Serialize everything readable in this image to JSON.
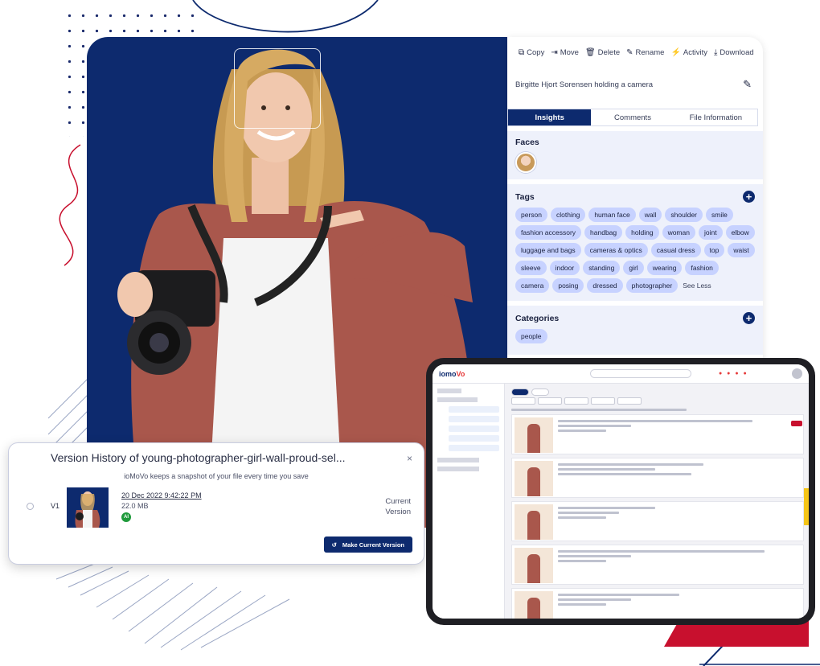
{
  "toolbar": {
    "items": [
      {
        "icon": "copy-icon",
        "label": "Copy"
      },
      {
        "icon": "move-icon",
        "label": "Move"
      },
      {
        "icon": "trash-icon",
        "label": "Delete"
      },
      {
        "icon": "pencil-icon",
        "label": "Rename"
      },
      {
        "icon": "activity-icon",
        "label": "Activity"
      },
      {
        "icon": "download-icon",
        "label": "Download"
      }
    ]
  },
  "file": {
    "title": "Birgitte Hjort Sorensen holding a camera"
  },
  "tabs": [
    "Insights",
    "Comments",
    "File Information"
  ],
  "faces": {
    "heading": "Faces"
  },
  "tags": {
    "heading": "Tags",
    "items": [
      "person",
      "clothing",
      "human face",
      "wall",
      "shoulder",
      "smile",
      "fashion accessory",
      "handbag",
      "holding",
      "woman",
      "joint",
      "elbow",
      "luggage and bags",
      "cameras & optics",
      "casual dress",
      "top",
      "waist",
      "sleeve",
      "indoor",
      "standing",
      "girl",
      "wearing",
      "fashion",
      "camera",
      "posing",
      "dressed",
      "photographer"
    ],
    "see_less": "See Less"
  },
  "categories": {
    "heading": "Categories",
    "items": [
      "people"
    ]
  },
  "version_history": {
    "title": "Version History of young-photographer-girl-wall-proud-sel...",
    "subtitle": "ioMoVo keeps a snapshot of your file every time you save",
    "close": "×",
    "version": "V1",
    "date": "20 Dec 2022 9:42:22 PM",
    "size": "22.0 MB",
    "badge": "AI",
    "status_line1": "Current",
    "status_line2": "Version",
    "button": "Make Current Version"
  },
  "laptop": {
    "logo_main": "iomo",
    "logo_accent": "Vo"
  },
  "colors": {
    "navy": "#0d2a6e",
    "tag_bg": "#c7d2ff",
    "accent_red": "#c8102e",
    "ai_green": "#1f9a3b"
  }
}
